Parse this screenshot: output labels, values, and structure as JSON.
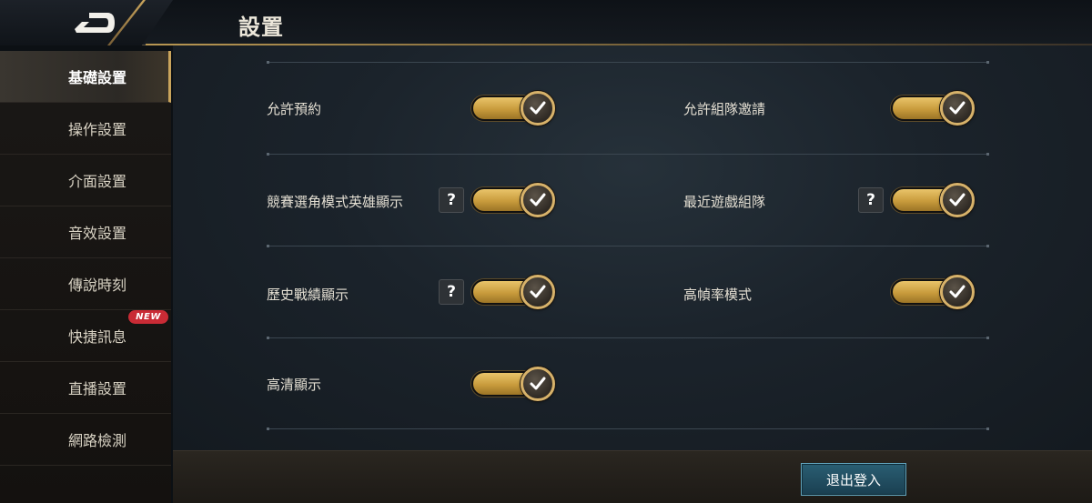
{
  "header": {
    "title": "設置"
  },
  "sidebar": {
    "items": [
      {
        "label": "基礎設置",
        "active": true
      },
      {
        "label": "操作設置"
      },
      {
        "label": "介面設置"
      },
      {
        "label": "音效設置"
      },
      {
        "label": "傳說時刻"
      },
      {
        "label": "快捷訊息",
        "badge": "NEW"
      },
      {
        "label": "直播設置"
      },
      {
        "label": "網路檢測"
      }
    ]
  },
  "settings": [
    {
      "label": "允許預約",
      "enabled": true,
      "help": false
    },
    {
      "label": "允許組隊邀請",
      "enabled": true,
      "help": false
    },
    {
      "label": "競賽選角模式英雄顯示",
      "enabled": true,
      "help": true
    },
    {
      "label": "最近遊戲組隊",
      "enabled": true,
      "help": true
    },
    {
      "label": "歷史戰績顯示",
      "enabled": true,
      "help": true
    },
    {
      "label": "高幀率模式",
      "enabled": true,
      "help": false
    },
    {
      "label": "高清顯示",
      "enabled": true,
      "help": false
    }
  ],
  "help_glyph": "?",
  "footer": {
    "logout_label": "退出登入"
  },
  "colors": {
    "accent_gold": "#c9a45c",
    "toggle_on": "#e0b552",
    "badge_red": "#c92b35",
    "button_teal": "#2a5e73"
  }
}
